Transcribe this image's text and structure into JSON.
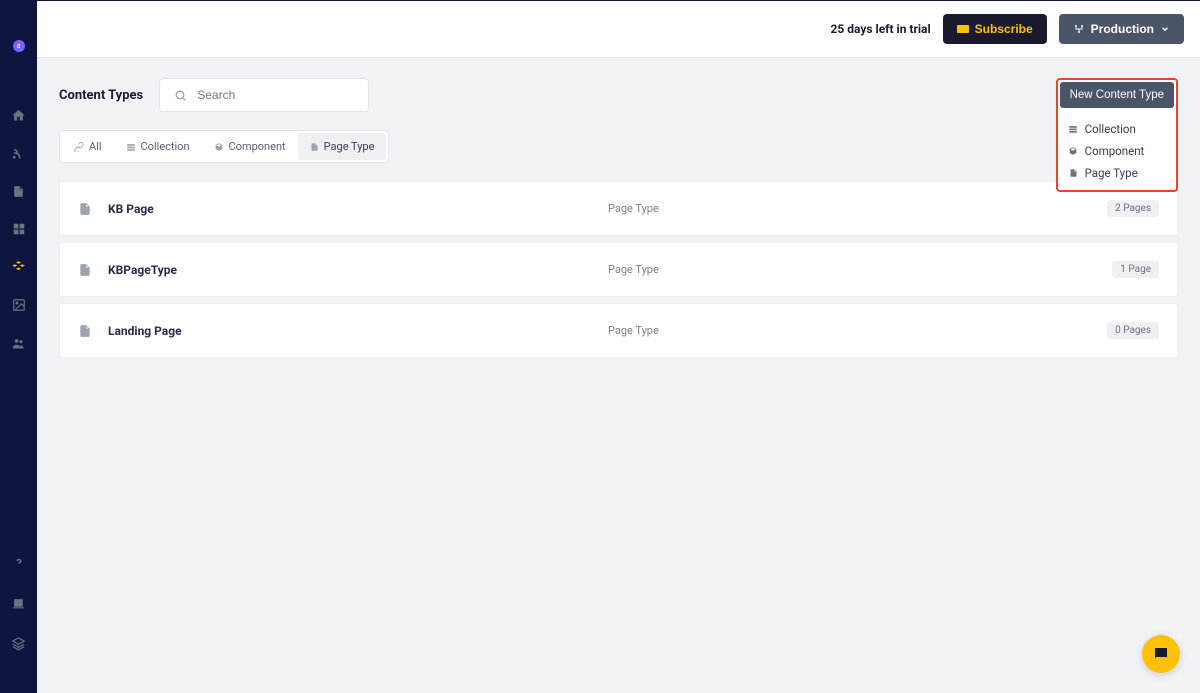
{
  "sidebar": {
    "avatar_initial": "a"
  },
  "topbar": {
    "trial_text": "25 days left in trial",
    "subscribe_label": "Subscribe",
    "production_label": "Production"
  },
  "header": {
    "title": "Content Types",
    "search_placeholder": "Search"
  },
  "new_content": {
    "button_label": "New Content Type",
    "options": [
      {
        "label": "Collection"
      },
      {
        "label": "Component"
      },
      {
        "label": "Page Type"
      }
    ]
  },
  "filters": [
    {
      "label": "All"
    },
    {
      "label": "Collection"
    },
    {
      "label": "Component"
    },
    {
      "label": "Page Type"
    }
  ],
  "rows": [
    {
      "name": "KB Page",
      "type": "Page Type",
      "badge": "2 Pages"
    },
    {
      "name": "KBPageType",
      "type": "Page Type",
      "badge": "1 Page"
    },
    {
      "name": "Landing Page",
      "type": "Page Type",
      "badge": "0 Pages"
    }
  ]
}
